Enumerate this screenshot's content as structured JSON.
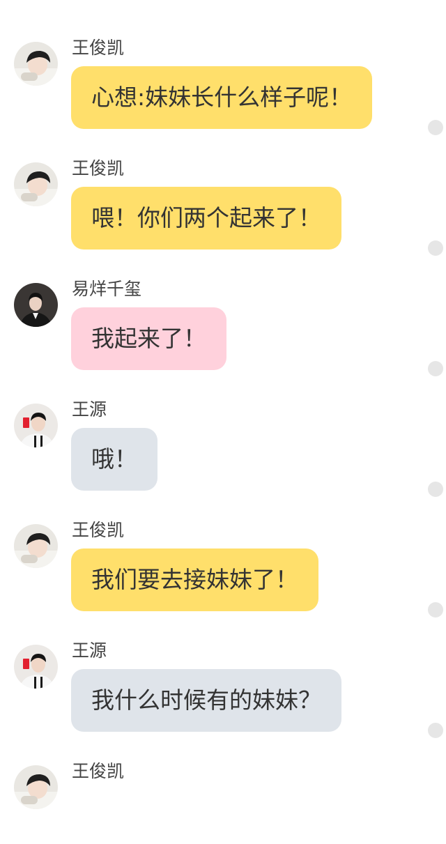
{
  "colors": {
    "bubble_yellow": "#ffdf6b",
    "bubble_pink": "#ffd1dc",
    "bubble_gray": "#dfe4ea",
    "dot": "#e6e6e6"
  },
  "messages": [
    {
      "sender": "王俊凯",
      "text": "心想:妹妹长什么样子呢！",
      "bubble_color": "yellow",
      "avatar_icon": "boy-lying-avatar-icon"
    },
    {
      "sender": "王俊凯",
      "text": "喂！你们两个起来了！",
      "bubble_color": "yellow",
      "avatar_icon": "boy-lying-avatar-icon"
    },
    {
      "sender": "易烊千玺",
      "text": "我起来了！",
      "bubble_color": "pink",
      "avatar_icon": "boy-suit-avatar-icon"
    },
    {
      "sender": "王源",
      "text": "哦！",
      "bubble_color": "gray",
      "avatar_icon": "boy-red-envelope-avatar-icon"
    },
    {
      "sender": "王俊凯",
      "text": "我们要去接妹妹了！",
      "bubble_color": "yellow",
      "avatar_icon": "boy-lying-avatar-icon"
    },
    {
      "sender": "王源",
      "text": "我什么时候有的妹妹？",
      "bubble_color": "gray",
      "avatar_icon": "boy-red-envelope-avatar-icon"
    },
    {
      "sender": "王俊凯",
      "text": "",
      "bubble_color": "yellow",
      "avatar_icon": "boy-lying-avatar-icon"
    }
  ]
}
